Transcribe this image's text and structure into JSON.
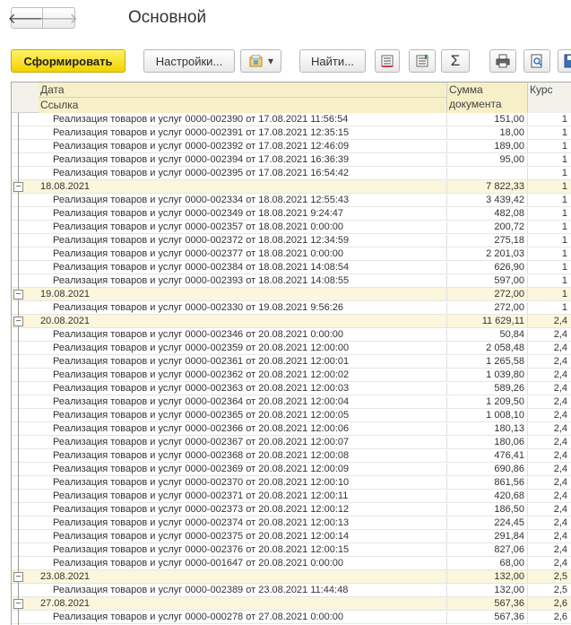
{
  "window": {
    "title": "Основной"
  },
  "nav": {
    "back": "🡐",
    "forward": "🡒"
  },
  "toolbar": {
    "generate_label": "Сформировать",
    "settings_label": "Настройки...",
    "variants_arrow": "▾",
    "find_label": "Найти...",
    "sum_symbol": "Σ"
  },
  "table": {
    "columns": {
      "date": "Дата",
      "ref": "Ссылка",
      "sum_line1": "Сумма",
      "sum_line2": "документа",
      "rate": "Курс"
    },
    "rows": [
      {
        "type": "detail",
        "name": "Реализация товаров и услуг 0000-002390 от 17.08.2021 11:56:54",
        "sum": "151,00",
        "rate": "1"
      },
      {
        "type": "detail",
        "name": "Реализация товаров и услуг 0000-002391 от 17.08.2021 12:35:15",
        "sum": "18,00",
        "rate": "1"
      },
      {
        "type": "detail",
        "name": "Реализация товаров и услуг 0000-002392 от 17.08.2021 12:46:09",
        "sum": "189,00",
        "rate": "1"
      },
      {
        "type": "detail",
        "name": "Реализация товаров и услуг 0000-002394 от 17.08.2021 16:36:39",
        "sum": "95,00",
        "rate": "1"
      },
      {
        "type": "detail",
        "name": "Реализация товаров и услуг 0000-002395 от 17.08.2021 16:54:42",
        "sum": "",
        "rate": "1"
      },
      {
        "type": "group",
        "name": "18.08.2021",
        "sum": "7 822,33",
        "rate": "1"
      },
      {
        "type": "detail",
        "name": "Реализация товаров и услуг 0000-002334 от 18.08.2021 12:55:43",
        "sum": "3 439,42",
        "rate": "1"
      },
      {
        "type": "detail",
        "name": "Реализация товаров и услуг 0000-002349 от 18.08.2021 9:24:47",
        "sum": "482,08",
        "rate": "1"
      },
      {
        "type": "detail",
        "name": "Реализация товаров и услуг 0000-002357 от 18.08.2021 0:00:00",
        "sum": "200,72",
        "rate": "1"
      },
      {
        "type": "detail",
        "name": "Реализация товаров и услуг 0000-002372 от 18.08.2021 12:34:59",
        "sum": "275,18",
        "rate": "1"
      },
      {
        "type": "detail",
        "name": "Реализация товаров и услуг 0000-002377 от 18.08.2021 0:00:00",
        "sum": "2 201,03",
        "rate": "1"
      },
      {
        "type": "detail",
        "name": "Реализация товаров и услуг 0000-002384 от 18.08.2021 14:08:54",
        "sum": "626,90",
        "rate": "1"
      },
      {
        "type": "detail",
        "name": "Реализация товаров и услуг 0000-002393 от 18.08.2021 14:08:55",
        "sum": "597,00",
        "rate": "1"
      },
      {
        "type": "group",
        "name": "19.08.2021",
        "sum": "272,00",
        "rate": "1"
      },
      {
        "type": "detail",
        "name": "Реализация товаров и услуг 0000-002330 от 19.08.2021 9:56:26",
        "sum": "272,00",
        "rate": "1"
      },
      {
        "type": "group",
        "name": "20.08.2021",
        "sum": "11 629,11",
        "rate": "2,4"
      },
      {
        "type": "detail",
        "name": "Реализация товаров и услуг 0000-002346 от 20.08.2021 0:00:00",
        "sum": "50,84",
        "rate": "2,4"
      },
      {
        "type": "detail",
        "name": "Реализация товаров и услуг 0000-002359 от 20.08.2021 12:00:00",
        "sum": "2 058,48",
        "rate": "2,4"
      },
      {
        "type": "detail",
        "name": "Реализация товаров и услуг 0000-002361 от 20.08.2021 12:00:01",
        "sum": "1 265,58",
        "rate": "2,4"
      },
      {
        "type": "detail",
        "name": "Реализация товаров и услуг 0000-002362 от 20.08.2021 12:00:02",
        "sum": "1 039,80",
        "rate": "2,4"
      },
      {
        "type": "detail",
        "name": "Реализация товаров и услуг 0000-002363 от 20.08.2021 12:00:03",
        "sum": "589,26",
        "rate": "2,4"
      },
      {
        "type": "detail",
        "name": "Реализация товаров и услуг 0000-002364 от 20.08.2021 12:00:04",
        "sum": "1 209,50",
        "rate": "2,4"
      },
      {
        "type": "detail",
        "name": "Реализация товаров и услуг 0000-002365 от 20.08.2021 12:00:05",
        "sum": "1 008,10",
        "rate": "2,4"
      },
      {
        "type": "detail",
        "name": "Реализация товаров и услуг 0000-002366 от 20.08.2021 12:00:06",
        "sum": "180,13",
        "rate": "2,4"
      },
      {
        "type": "detail",
        "name": "Реализация товаров и услуг 0000-002367 от 20.08.2021 12:00:07",
        "sum": "180,06",
        "rate": "2,4"
      },
      {
        "type": "detail",
        "name": "Реализация товаров и услуг 0000-002368 от 20.08.2021 12:00:08",
        "sum": "476,41",
        "rate": "2,4"
      },
      {
        "type": "detail",
        "name": "Реализация товаров и услуг 0000-002369 от 20.08.2021 12:00:09",
        "sum": "690,86",
        "rate": "2,4"
      },
      {
        "type": "detail",
        "name": "Реализация товаров и услуг 0000-002370 от 20.08.2021 12:00:10",
        "sum": "861,56",
        "rate": "2,4"
      },
      {
        "type": "detail",
        "name": "Реализация товаров и услуг 0000-002371 от 20.08.2021 12:00:11",
        "sum": "420,68",
        "rate": "2,4"
      },
      {
        "type": "detail",
        "name": "Реализация товаров и услуг 0000-002373 от 20.08.2021 12:00:12",
        "sum": "186,50",
        "rate": "2,4"
      },
      {
        "type": "detail",
        "name": "Реализация товаров и услуг 0000-002374 от 20.08.2021 12:00:13",
        "sum": "224,45",
        "rate": "2,4"
      },
      {
        "type": "detail",
        "name": "Реализация товаров и услуг 0000-002375 от 20.08.2021 12:00:14",
        "sum": "291,84",
        "rate": "2,4"
      },
      {
        "type": "detail",
        "name": "Реализация товаров и услуг 0000-002376 от 20.08.2021 12:00:15",
        "sum": "827,06",
        "rate": "2,4"
      },
      {
        "type": "detail",
        "name": "Реализация товаров и услуг 0000-001647 от 20.08.2021 0:00:00",
        "sum": "68,00",
        "rate": "2,4"
      },
      {
        "type": "group",
        "name": "23.08.2021",
        "sum": "132,00",
        "rate": "2,5"
      },
      {
        "type": "detail",
        "name": "Реализация товаров и услуг 0000-002389 от 23.08.2021 11:44:48",
        "sum": "132,00",
        "rate": "2,5"
      },
      {
        "type": "group",
        "name": "27.08.2021",
        "sum": "567,36",
        "rate": "2,6"
      },
      {
        "type": "detail",
        "name": "Реализация товаров и услуг 0000-000278 от 27.08.2021 0:00:00",
        "sum": "567,36",
        "rate": "2,6"
      }
    ]
  }
}
